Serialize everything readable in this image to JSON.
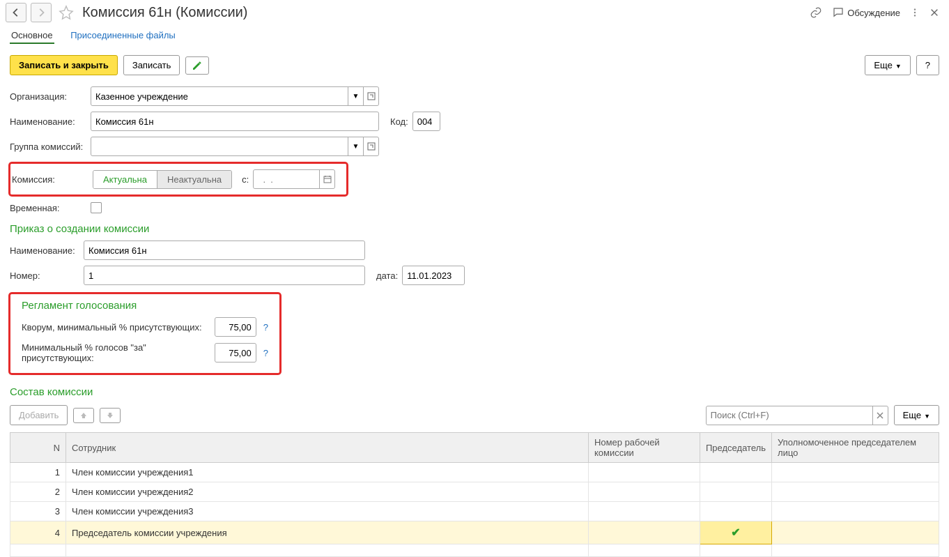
{
  "header": {
    "title": "Комиссия 61н (Комиссии)",
    "discuss": "Обсуждение"
  },
  "tabs": {
    "main": "Основное",
    "files": "Присоединенные файлы"
  },
  "toolbar": {
    "save_close": "Записать и закрыть",
    "save": "Записать",
    "more": "Еще",
    "help": "?"
  },
  "form": {
    "org_label": "Организация:",
    "org_value": "Казенное учреждение",
    "name_label": "Наименование:",
    "name_value": "Комиссия 61н",
    "code_label": "Код:",
    "code_value": "004",
    "group_label": "Группа комиссий:",
    "comm_label": "Комиссия:",
    "actual": "Актуальна",
    "not_actual": "Неактуальна",
    "from_label": "с:",
    "from_placeholder": "  .  .    ",
    "temp_label": "Временная:"
  },
  "order": {
    "title": "Приказ о создании комиссии",
    "name_label": "Наименование:",
    "name_value": "Комиссия 61н",
    "num_label": "Номер:",
    "num_value": "1",
    "date_label": "дата:",
    "date_value": "11.01.2023"
  },
  "voting": {
    "title": "Регламент голосования",
    "quorum_label": "Кворум, минимальный % присутствующих:",
    "quorum_value": "75,00",
    "min_yes_label": "Минимальный % голосов \"за\" присутствующих:",
    "min_yes_value": "75,00"
  },
  "members": {
    "title": "Состав комиссии",
    "add": "Добавить",
    "more": "Еще",
    "search_placeholder": "Поиск (Ctrl+F)",
    "cols": {
      "n": "N",
      "employee": "Сотрудник",
      "worknum": "Номер рабочей комиссии",
      "chair": "Председатель",
      "auth": "Уполномоченное председателем лицо"
    },
    "rows": [
      {
        "n": "1",
        "employee": "Член комиссии учреждения1",
        "chair": false
      },
      {
        "n": "2",
        "employee": "Член комиссии учреждения2",
        "chair": false
      },
      {
        "n": "3",
        "employee": "Член комиссии учреждения3",
        "chair": false
      },
      {
        "n": "4",
        "employee": "Председатель комиссии учреждения",
        "chair": true
      }
    ]
  }
}
